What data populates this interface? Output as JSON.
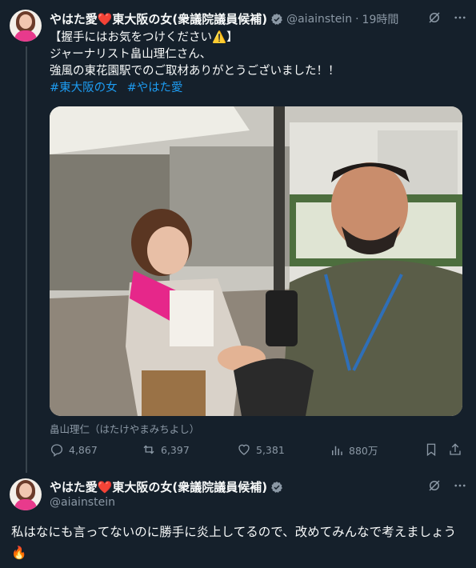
{
  "tweet": {
    "display_name": "やはた愛❤️東大阪の女(衆議院議員候補)",
    "handle": "@aiainstein",
    "dot": "·",
    "time": "19時間",
    "lines": [
      "【握手にはお気をつけください⚠️】",
      "ジャーナリスト畠山理仁さん、",
      "強風の東花園駅でのご取材ありがとうございました！！"
    ],
    "hashtags": [
      "#東大阪の女",
      "#やはた愛"
    ],
    "photo_caption": "畠山理仁（はたけやまみちよし）",
    "stats": {
      "replies": "4,867",
      "reposts": "6,397",
      "likes": "5,381",
      "views": "880万"
    }
  },
  "reply": {
    "display_name": "やはた愛❤️東大阪の女(衆議院議員候補)",
    "handle": "@aiainstein",
    "text": "私はなにも言ってないのに勝手に炎上してるので、改めてみんなで考えましょう🔥"
  },
  "icons": [
    "grok-icon",
    "more-icon",
    "reply-icon",
    "repost-icon",
    "like-icon",
    "views-icon",
    "bookmark-icon",
    "share-icon",
    "verified-badge-icon"
  ],
  "colors": {
    "background": "#15202b",
    "link": "#1d9bf0",
    "muted": "#8b98a5",
    "verified": "#8b98a5"
  }
}
